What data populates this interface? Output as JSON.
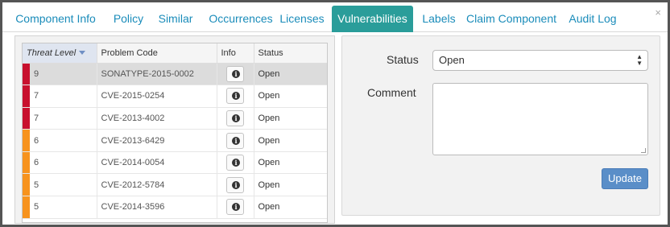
{
  "tabs": [
    {
      "label": "Component Info",
      "active": false
    },
    {
      "label": "Policy",
      "active": false
    },
    {
      "label": "Similar",
      "active": false
    },
    {
      "label": "Occurrences",
      "active": false
    },
    {
      "label": "Licenses",
      "active": false
    },
    {
      "label": "Vulnerabilities",
      "active": true
    },
    {
      "label": "Labels",
      "active": false
    },
    {
      "label": "Claim Component",
      "active": false
    },
    {
      "label": "Audit Log",
      "active": false
    }
  ],
  "close_glyph": "×",
  "table": {
    "columns": [
      "Threat Level",
      "Problem Code",
      "Info",
      "Status"
    ],
    "sorted_column": "Threat Level",
    "rows": [
      {
        "level": "9",
        "code": "SONATYPE-2015-0002",
        "status": "Open",
        "color": "#c8102e",
        "selected": true
      },
      {
        "level": "7",
        "code": "CVE-2015-0254",
        "status": "Open",
        "color": "#c8102e",
        "selected": false
      },
      {
        "level": "7",
        "code": "CVE-2013-4002",
        "status": "Open",
        "color": "#c8102e",
        "selected": false
      },
      {
        "level": "6",
        "code": "CVE-2013-6429",
        "status": "Open",
        "color": "#f7931e",
        "selected": false
      },
      {
        "level": "6",
        "code": "CVE-2014-0054",
        "status": "Open",
        "color": "#f7931e",
        "selected": false
      },
      {
        "level": "5",
        "code": "CVE-2012-5784",
        "status": "Open",
        "color": "#f7931e",
        "selected": false
      },
      {
        "level": "5",
        "code": "CVE-2014-3596",
        "status": "Open",
        "color": "#f7931e",
        "selected": false
      }
    ],
    "info_icon": "info-circle-icon"
  },
  "form": {
    "status_label": "Status",
    "status_value": "Open",
    "comment_label": "Comment",
    "comment_value": "",
    "update_label": "Update"
  },
  "colors": {
    "accent": "#2a9d9a",
    "link": "#1a8cba",
    "critical": "#c8102e",
    "severe": "#f7931e",
    "button": "#5a8ec8"
  }
}
